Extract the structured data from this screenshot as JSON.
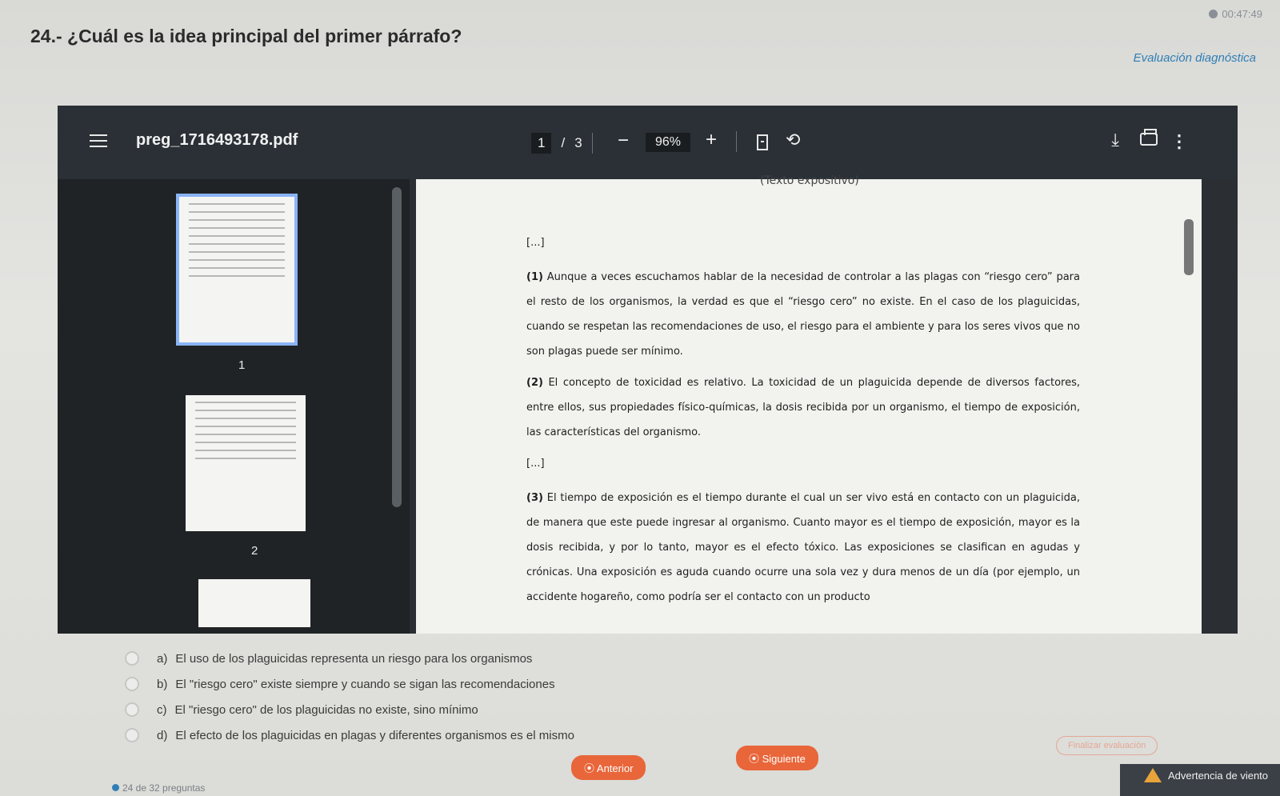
{
  "timer": "00:47:49",
  "question": {
    "title": "24.- ¿Cuál es la idea principal del primer párrafo?",
    "evaluation_label": "Evaluación diagnóstica"
  },
  "viewer": {
    "file_name": "preg_1716493178.pdf",
    "current_page": "1",
    "page_separator": "/",
    "total_pages": "3",
    "zoom_out": "−",
    "zoom": "96%",
    "zoom_in": "+",
    "thumbnails": [
      "1",
      "2"
    ],
    "icons": [
      "menu-icon",
      "fit-page-icon",
      "rotate-icon",
      "download-icon",
      "print-icon",
      "more-icon"
    ]
  },
  "document": {
    "header": "(Texto expositivo)",
    "ellipsis_1": "[...]",
    "p1_num": "(1)",
    "p1": "Aunque a veces escuchamos hablar de la necesidad de controlar a las plagas con “riesgo cero” para el resto de los organismos, la verdad es que el “riesgo cero” no existe. En el caso de los plaguicidas, cuando se respetan las recomendaciones de uso, el riesgo para el ambiente y para los seres vivos que no son plagas puede ser mínimo.",
    "p2_num": "(2)",
    "p2": "El concepto de toxicidad es relativo. La toxicidad de un plaguicida depende de diversos factores, entre ellos, sus propiedades físico-químicas, la dosis recibida por un organismo, el tiempo de exposición, las características del organismo.",
    "ellipsis_2": "[...]",
    "p3_num": "(3)",
    "p3": "El tiempo de exposición es el tiempo durante el cual un ser vivo está en contacto con un plaguicida, de manera que este puede ingresar al organismo. Cuanto mayor es el tiempo de exposición, mayor es la dosis recibida, y por lo tanto, mayor es el efecto tóxico. Las exposiciones se clasifican en agudas y crónicas. Una exposición es aguda cuando ocurre una sola vez y dura menos de un día (por ejemplo, un accidente hogareño, como podría ser el contacto con un producto"
  },
  "options": [
    {
      "letter": "a)",
      "text": "El uso de los plaguicidas representa un riesgo para los organismos"
    },
    {
      "letter": "b)",
      "text": "El \"riesgo cero\" existe siempre y cuando se sigan las recomendaciones"
    },
    {
      "letter": "c)",
      "text": "El \"riesgo cero\" de los plaguicidas no existe, sino mínimo"
    },
    {
      "letter": "d)",
      "text": "El efecto de los plaguicidas en plagas y diferentes organismos es el mismo"
    }
  ],
  "nav": {
    "prev": "⦿ Anterior",
    "next": "⦿ Siguiente",
    "finish": "Finalizar evaluación",
    "progress": "24 de 32 preguntas",
    "warning": "Advertencia de viento"
  },
  "colors": {
    "accent": "#e8663a",
    "link": "#2f7fb5",
    "viewer_bg": "#2a3035"
  }
}
